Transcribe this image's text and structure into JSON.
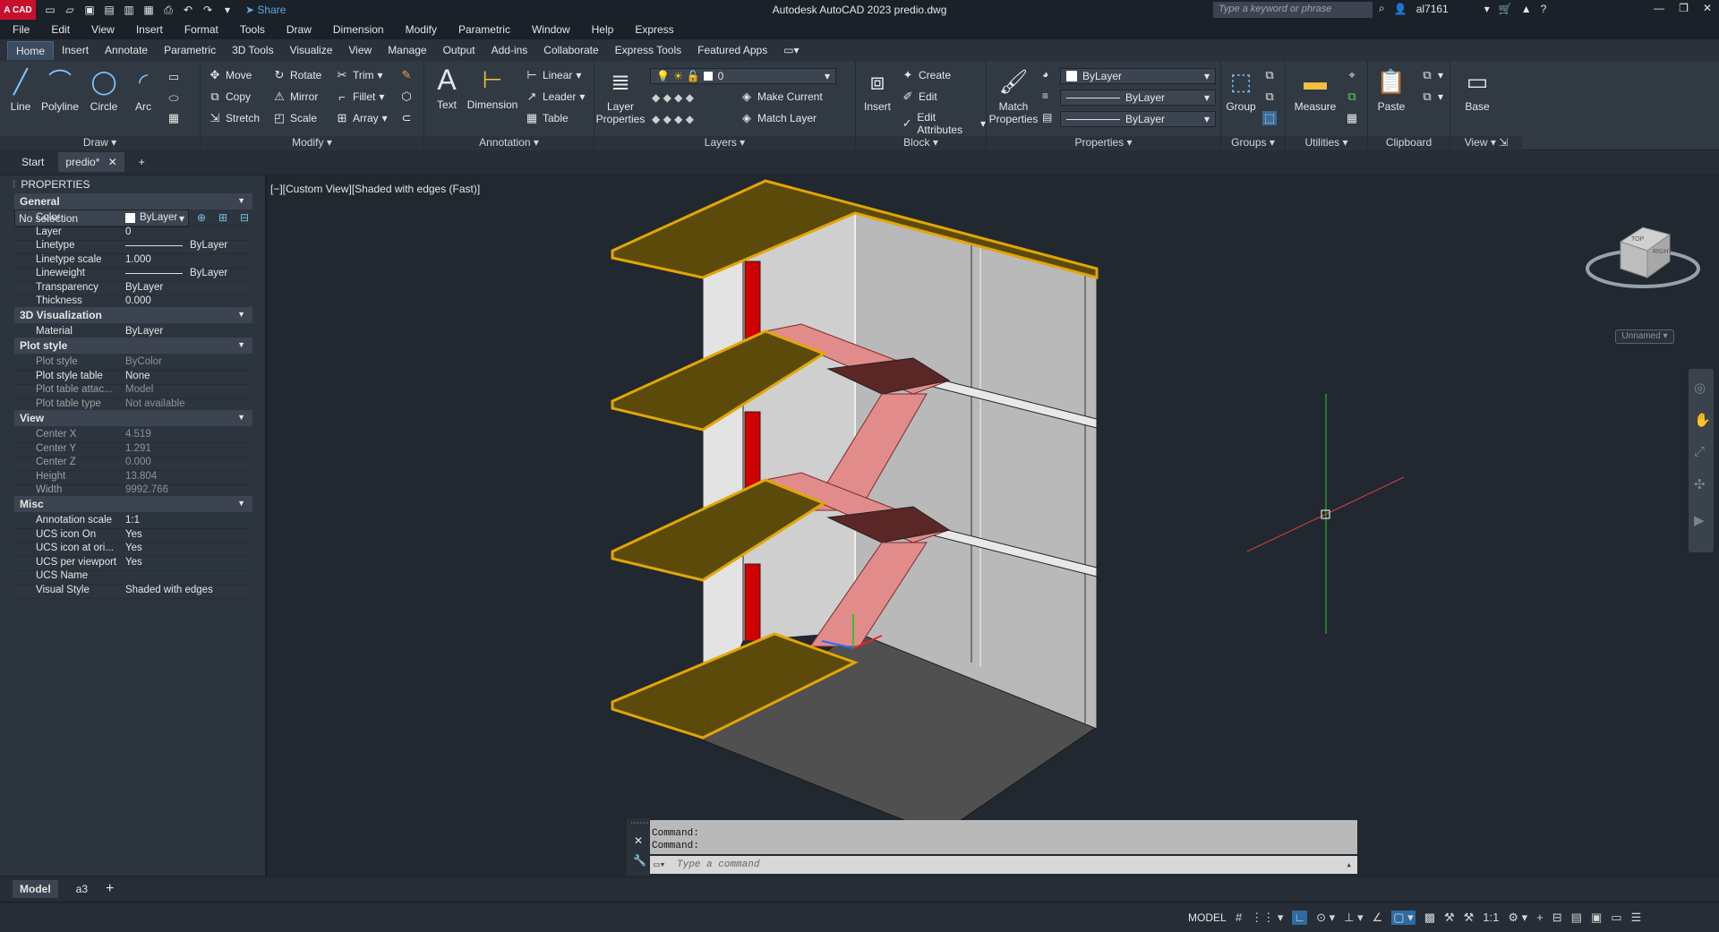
{
  "app": {
    "logo_text": "A CAD",
    "window_title": "Autodesk AutoCAD 2023    predio.dwg",
    "share_label": "Share",
    "search_placeholder": "Type a keyword or phrase",
    "user": "al7161"
  },
  "menu": [
    "File",
    "Edit",
    "View",
    "Insert",
    "Format",
    "Tools",
    "Draw",
    "Dimension",
    "Modify",
    "Parametric",
    "Window",
    "Help",
    "Express"
  ],
  "ribbon_tabs": [
    "Home",
    "Insert",
    "Annotate",
    "Parametric",
    "3D Tools",
    "Visualize",
    "View",
    "Manage",
    "Output",
    "Add-ins",
    "Collaborate",
    "Express Tools",
    "Featured Apps"
  ],
  "ribbon": {
    "draw": {
      "title": "Draw",
      "line": "Line",
      "polyline": "Polyline",
      "circle": "Circle",
      "arc": "Arc"
    },
    "modify": {
      "title": "Modify",
      "move": "Move",
      "rotate": "Rotate",
      "trim": "Trim",
      "copy": "Copy",
      "mirror": "Mirror",
      "fillet": "Fillet",
      "stretch": "Stretch",
      "scale": "Scale",
      "array": "Array"
    },
    "annotation": {
      "title": "Annotation",
      "text": "Text",
      "dimension": "Dimension",
      "linear": "Linear",
      "leader": "Leader",
      "table": "Table"
    },
    "layers": {
      "title": "Layers",
      "layer_properties_1": "Layer",
      "layer_properties_2": "Properties",
      "current_layer": "0",
      "make_current": "Make Current",
      "match_layer": "Match Layer"
    },
    "block": {
      "title": "Block",
      "insert": "Insert",
      "create": "Create",
      "edit": "Edit",
      "edit_attributes": "Edit Attributes"
    },
    "properties": {
      "title": "Properties",
      "match_1": "Match",
      "match_2": "Properties",
      "color": "ByLayer",
      "linetype": "ByLayer",
      "lineweight": "ByLayer"
    },
    "groups": {
      "title": "Groups",
      "group": "Group"
    },
    "utilities": {
      "title": "Utilities",
      "measure": "Measure"
    },
    "clipboard": {
      "title": "Clipboard",
      "paste": "Paste"
    },
    "view": {
      "title": "View",
      "base": "Base"
    }
  },
  "file_tabs": {
    "start": "Start",
    "active": "predio*"
  },
  "properties_palette": {
    "header": "PROPERTIES",
    "selection": "No selection",
    "sections": {
      "general": {
        "title": "General",
        "rows": [
          {
            "k": "Color",
            "v": "ByLayer"
          },
          {
            "k": "Layer",
            "v": "0"
          },
          {
            "k": "Linetype",
            "v": "ByLayer"
          },
          {
            "k": "Linetype scale",
            "v": "1.000"
          },
          {
            "k": "Lineweight",
            "v": "ByLayer"
          },
          {
            "k": "Transparency",
            "v": "ByLayer"
          },
          {
            "k": "Thickness",
            "v": "0.000"
          }
        ]
      },
      "viz": {
        "title": "3D Visualization",
        "rows": [
          {
            "k": "Material",
            "v": "ByLayer"
          }
        ]
      },
      "plot": {
        "title": "Plot style",
        "rows": [
          {
            "k": "Plot style",
            "v": "ByColor"
          },
          {
            "k": "Plot style table",
            "v": "None"
          },
          {
            "k": "Plot table attac...",
            "v": "Model"
          },
          {
            "k": "Plot table type",
            "v": "Not available"
          }
        ]
      },
      "view": {
        "title": "View",
        "rows": [
          {
            "k": "Center X",
            "v": "4.519"
          },
          {
            "k": "Center Y",
            "v": "1.291"
          },
          {
            "k": "Center Z",
            "v": "0.000"
          },
          {
            "k": "Height",
            "v": "13.804"
          },
          {
            "k": "Width",
            "v": "9992.766"
          }
        ]
      },
      "misc": {
        "title": "Misc",
        "rows": [
          {
            "k": "Annotation scale",
            "v": "1:1"
          },
          {
            "k": "UCS icon On",
            "v": "Yes"
          },
          {
            "k": "UCS icon at ori...",
            "v": "Yes"
          },
          {
            "k": "UCS per viewport",
            "v": "Yes"
          },
          {
            "k": "UCS Name",
            "v": ""
          },
          {
            "k": "Visual Style",
            "v": "Shaded with edges"
          }
        ]
      }
    }
  },
  "viewport": {
    "label": "[−][Custom View][Shaded with edges (Fast)]",
    "named_view": "Unnamed",
    "cube_top": "TOP",
    "cube_right": "RIGHT"
  },
  "command": {
    "line1": "Command:",
    "line2": "Command:",
    "placeholder": "Type a command"
  },
  "layouts": [
    "Model",
    "a3"
  ],
  "status": {
    "model": "MODEL",
    "scale": "1:1"
  },
  "colors": {
    "accent": "#0696d7",
    "slab": "#e3a600",
    "stair": "#e28b8b",
    "red": "#d10000"
  }
}
